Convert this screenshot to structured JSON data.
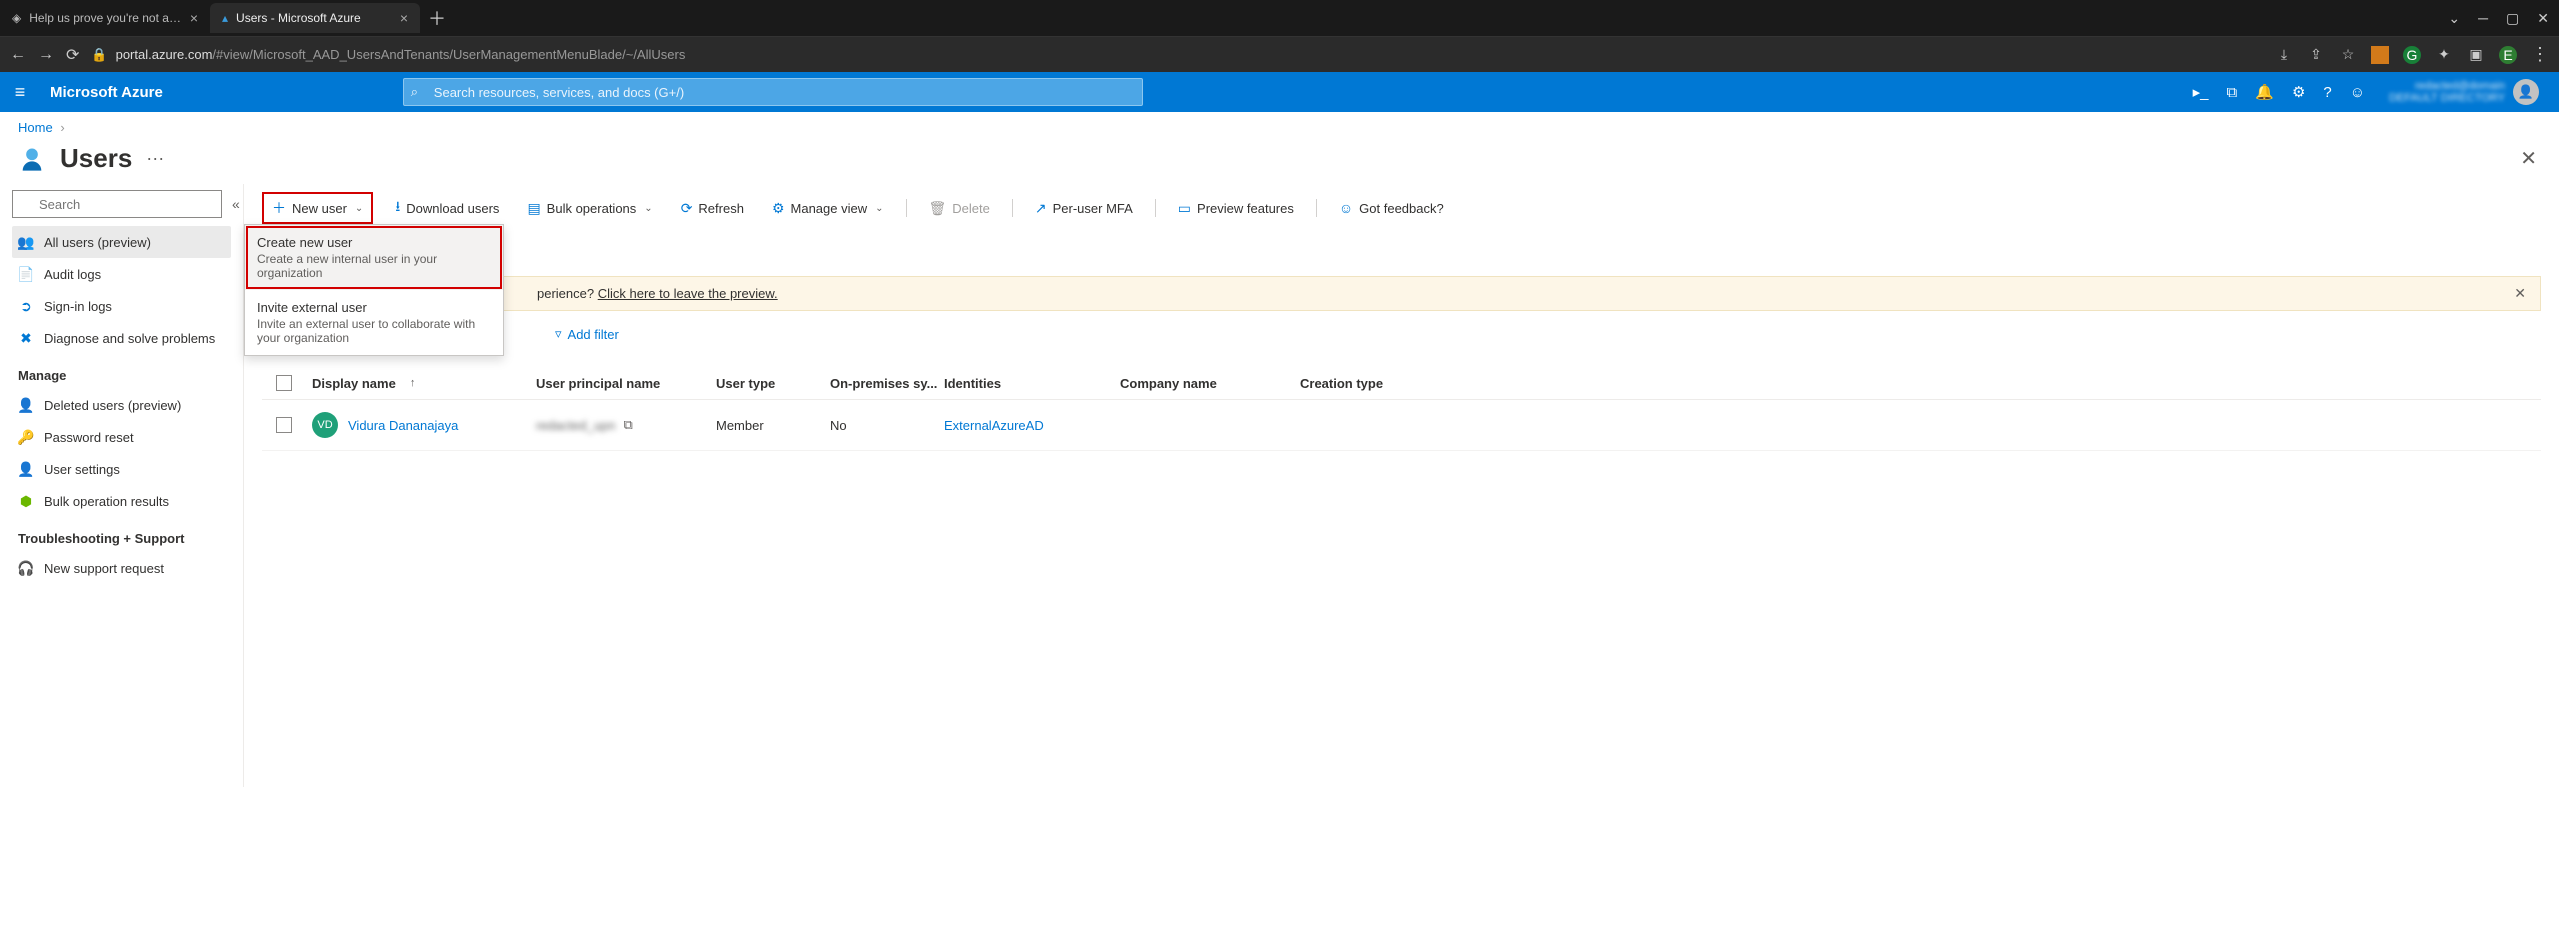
{
  "browser": {
    "tabs": [
      {
        "title": "Help us prove you're not a robot",
        "active": false
      },
      {
        "title": "Users - Microsoft Azure",
        "active": true
      }
    ],
    "url_host": "portal.azure.com",
    "url_path": "/#view/Microsoft_AAD_UsersAndTenants/UserManagementMenuBlade/~/AllUsers"
  },
  "azure_top": {
    "brand": "Microsoft Azure",
    "search_placeholder": "Search resources, services, and docs (G+/)"
  },
  "breadcrumb": {
    "home": "Home"
  },
  "page": {
    "title": "Users",
    "more": "···"
  },
  "sidebar": {
    "search_placeholder": "Search",
    "top_items": [
      {
        "label": "All users (preview)",
        "icon": "users-icon",
        "active": true
      },
      {
        "label": "Audit logs",
        "icon": "log-icon"
      },
      {
        "label": "Sign-in logs",
        "icon": "signin-icon"
      },
      {
        "label": "Diagnose and solve problems",
        "icon": "wrench-icon"
      }
    ],
    "manage_header": "Manage",
    "manage_items": [
      {
        "label": "Deleted users (preview)",
        "icon": "deleted-user-icon"
      },
      {
        "label": "Password reset",
        "icon": "key-icon"
      },
      {
        "label": "User settings",
        "icon": "user-settings-icon"
      },
      {
        "label": "Bulk operation results",
        "icon": "bulk-icon"
      }
    ],
    "support_header": "Troubleshooting + Support",
    "support_items": [
      {
        "label": "New support request",
        "icon": "support-icon"
      }
    ]
  },
  "toolbar": {
    "new_user": "New user",
    "download_users": "Download users",
    "bulk_operations": "Bulk operations",
    "refresh": "Refresh",
    "manage_view": "Manage view",
    "delete": "Delete",
    "per_user_mfa": "Per-user MFA",
    "preview_features": "Preview features",
    "feedback": "Got feedback?"
  },
  "dropdown": {
    "create_title": "Create new user",
    "create_desc": "Create a new internal user in your organization",
    "invite_title": "Invite external user",
    "invite_desc": "Invite an external user to collaborate with your organization"
  },
  "banner": {
    "text_suffix": "perience? ",
    "link_text": "Click here to leave the preview."
  },
  "filter": {
    "add_filter": "Add filter"
  },
  "table": {
    "columns": {
      "display_name": "Display name",
      "upn": "User principal name",
      "user_type": "User type",
      "on_prem": "On-premises sy...",
      "identities": "Identities",
      "company": "Company name",
      "creation": "Creation type"
    },
    "rows": [
      {
        "avatar_initials": "VD",
        "display_name": "Vidura Dananajaya",
        "upn_blur": "redacted_upn",
        "user_type": "Member",
        "on_prem": "No",
        "identities": "ExternalAzureAD",
        "company": "",
        "creation": ""
      }
    ]
  }
}
